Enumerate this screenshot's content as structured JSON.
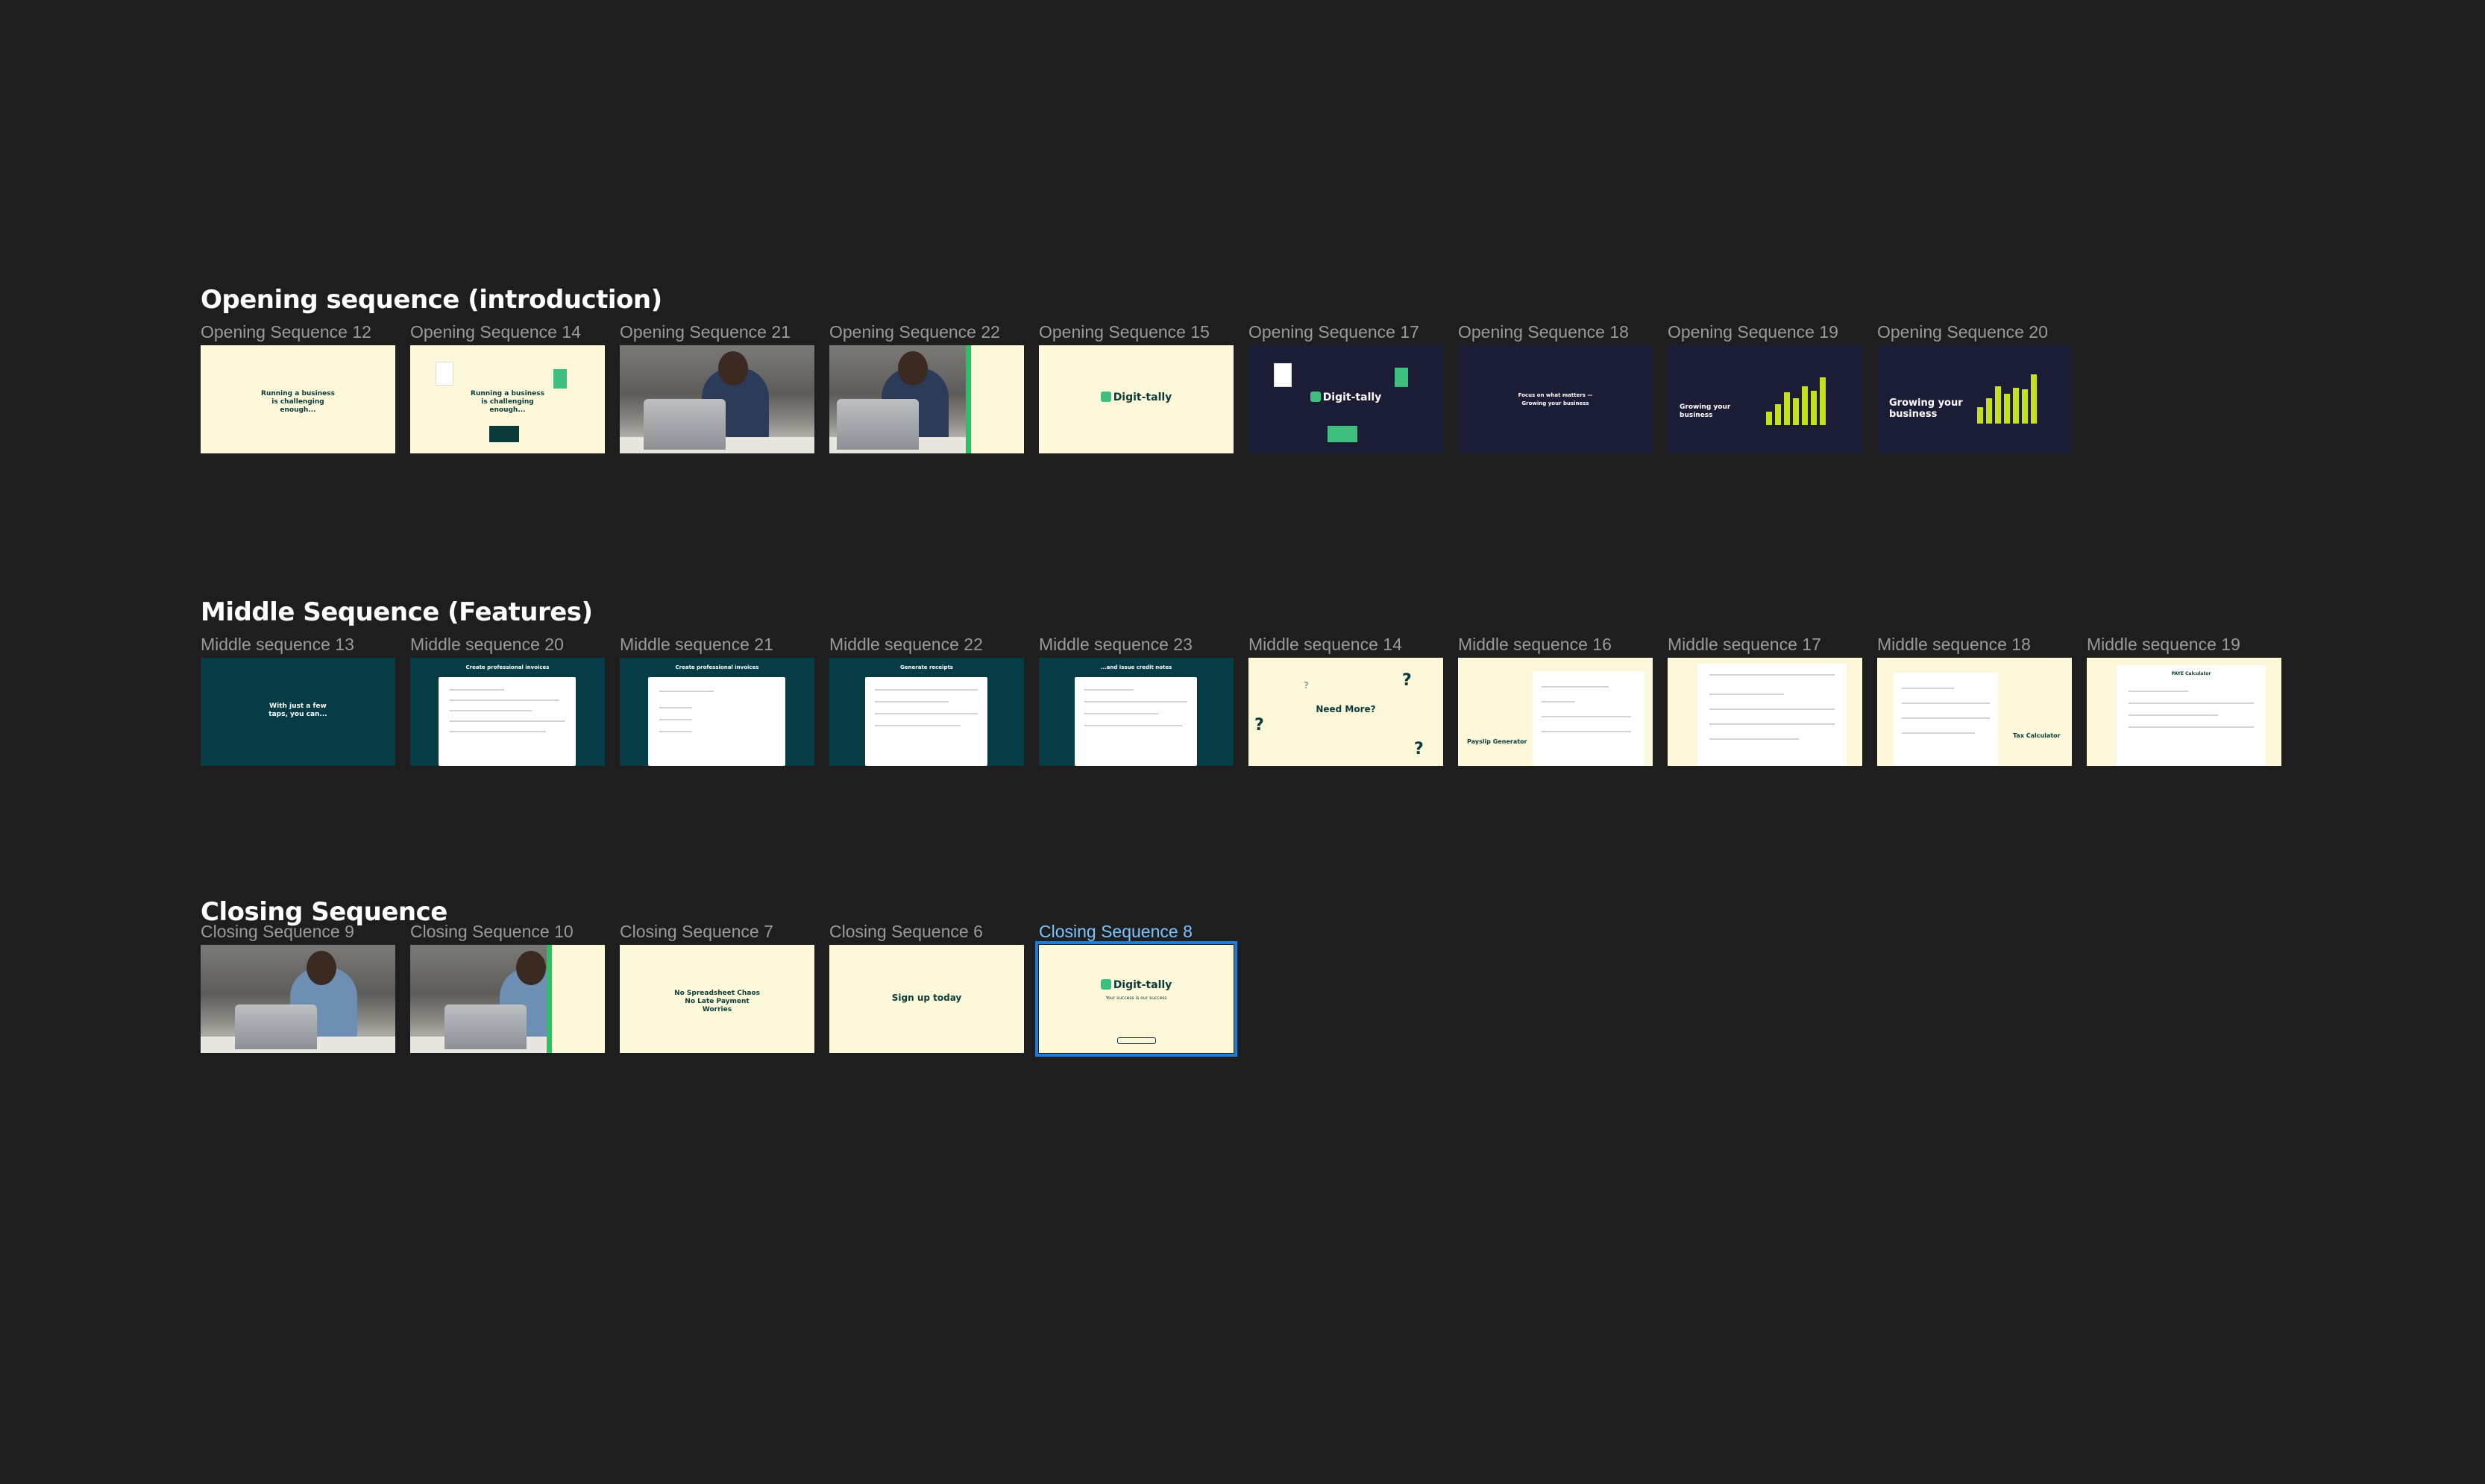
{
  "sections": {
    "opening": {
      "title": "Opening sequence (introduction)",
      "frames": [
        {
          "label": "Opening Sequence 12",
          "text": "Running a business is challenging enough..."
        },
        {
          "label": "Opening Sequence 14",
          "text": "Running a business is challenging enough..."
        },
        {
          "label": "Opening Sequence 21"
        },
        {
          "label": "Opening Sequence 22"
        },
        {
          "label": "Opening Sequence 15",
          "logo": "Digit-tally"
        },
        {
          "label": "Opening Sequence 17",
          "logo": "Digit-tally"
        },
        {
          "label": "Opening Sequence 18",
          "text": "Focus on what matters — Growing your business"
        },
        {
          "label": "Opening Sequence 19",
          "text": "Growing your business"
        },
        {
          "label": "Opening Sequence 20",
          "text": "Growing your business"
        }
      ]
    },
    "middle": {
      "title": "Middle Sequence (Features)",
      "frames": [
        {
          "label": "Middle sequence 13",
          "text": "With just a few taps, you can..."
        },
        {
          "label": "Middle sequence 20",
          "text": "Create professional invoices"
        },
        {
          "label": "Middle sequence 21",
          "text": "Create professional invoices"
        },
        {
          "label": "Middle sequence 22",
          "text": "Generate receipts"
        },
        {
          "label": "Middle sequence 23",
          "text": "...and issue credit notes"
        },
        {
          "label": "Middle sequence 14",
          "text": "Need More?"
        },
        {
          "label": "Middle sequence 16",
          "text": "Payslip Generator"
        },
        {
          "label": "Middle sequence 17"
        },
        {
          "label": "Middle sequence 18",
          "text": "Tax Calculator"
        },
        {
          "label": "Middle sequence 19",
          "text": "PAYE Calculator"
        }
      ]
    },
    "closing": {
      "title": "Closing Sequence",
      "frames": [
        {
          "label": "Closing Sequence 9"
        },
        {
          "label": "Closing Sequence 10"
        },
        {
          "label": "Closing Sequence 7",
          "text": "No Spreadsheet Chaos No Late Payment Worries"
        },
        {
          "label": "Closing Sequence 6",
          "text": "Sign up today"
        },
        {
          "label": "Closing Sequence 8",
          "logo": "Digit-tally",
          "text": "Your success is our success",
          "selected": true
        }
      ]
    }
  },
  "colors": {
    "canvas": "#1e1e1e",
    "cream": "#fdf8da",
    "navy": "#1b1d36",
    "teal": "#063c45",
    "selection": "#1e7bd6",
    "brand_green": "#3fbf7f"
  }
}
